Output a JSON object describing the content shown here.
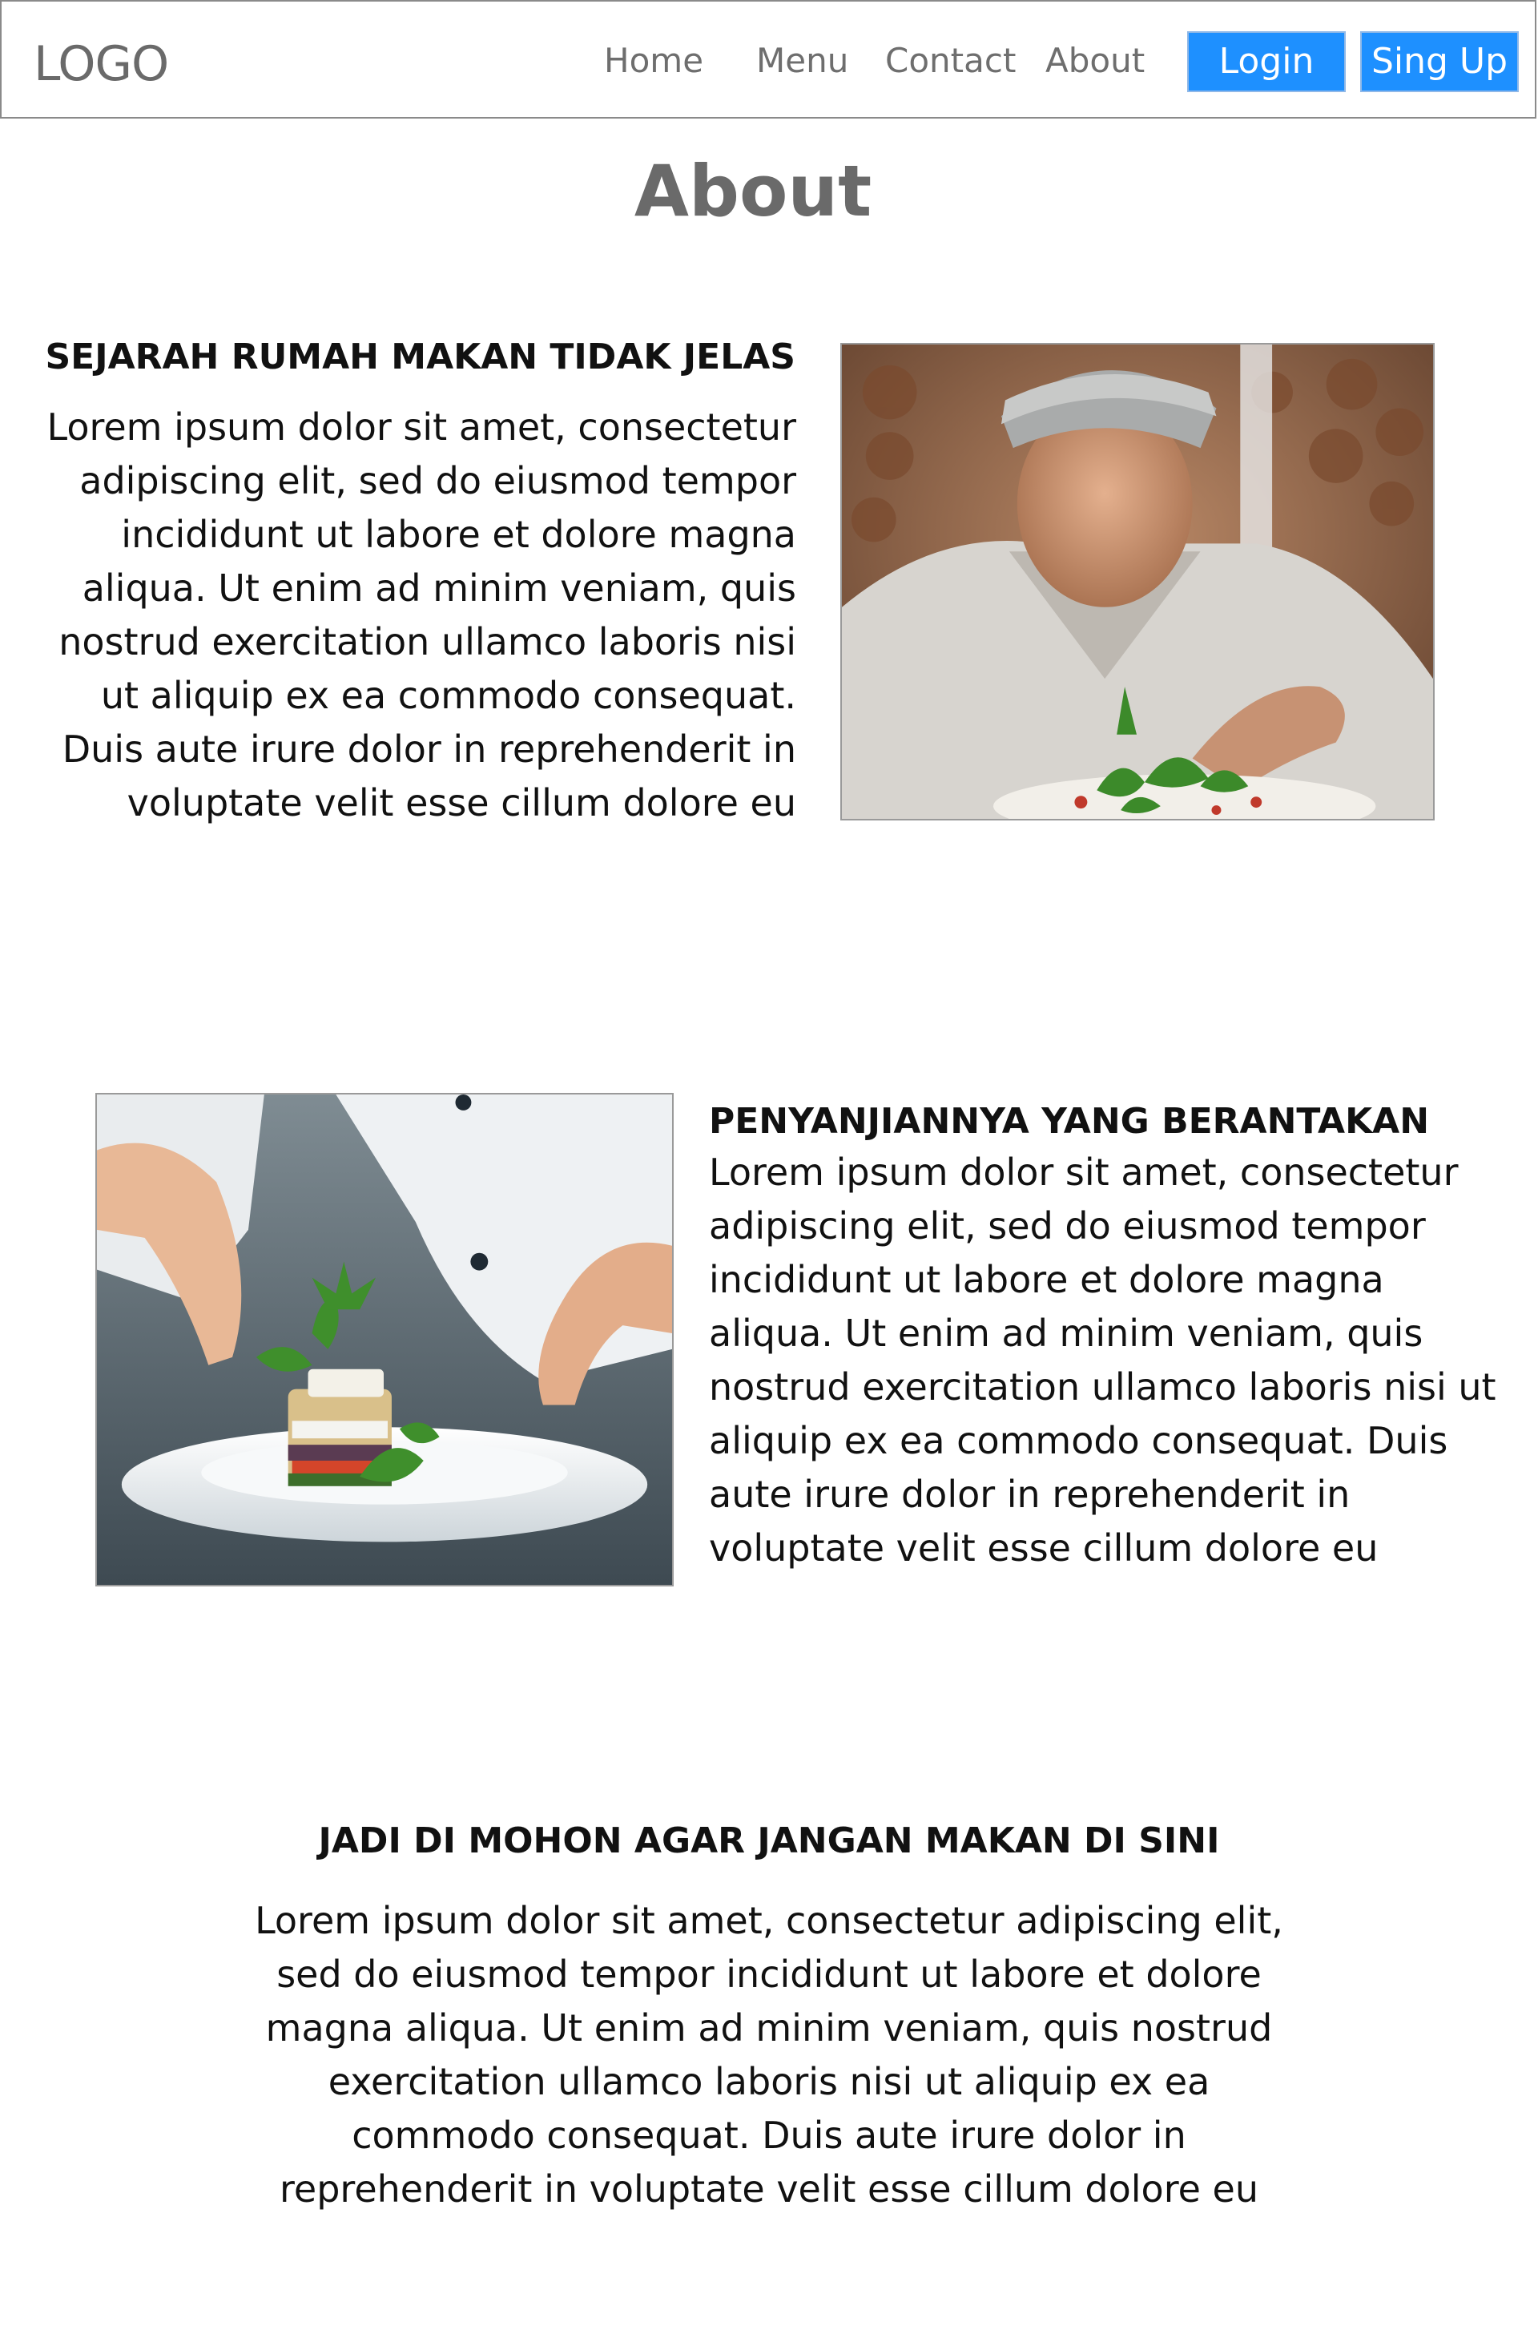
{
  "navbar": {
    "logo": "LOGO",
    "links": [
      "Home",
      "Menu",
      "Contact",
      "About"
    ],
    "login_label": "Login",
    "signup_label": "Sing Up",
    "accent": "#1e90ff"
  },
  "page": {
    "title": "About"
  },
  "sections": [
    {
      "heading": "SEJARAH RUMAH MAKAN TIDAK JELAS",
      "text": "Lorem ipsum dolor sit amet, consectetur adipiscing elit, sed do eiusmod tempor incididunt ut labore et dolore magna aliqua. Ut enim ad minim veniam, quis nostrud exercitation ullamco laboris nisi ut aliquip ex ea commodo consequat. Duis aute irure dolor in reprehenderit in voluptate velit esse cillum dolore eu",
      "image": "chef-garnishing-photo"
    },
    {
      "heading": "PENYANJIANNYA YANG BERANTAKAN",
      "text": "Lorem ipsum dolor sit amet, consectetur adipiscing elit, sed do eiusmod tempor incididunt ut labore et dolore magna aliqua. Ut enim ad minim veniam, quis nostrud exercitation ullamco laboris nisi ut aliquip ex ea commodo consequat. Duis aute irure dolor in reprehenderit in voluptate velit esse cillum dolore eu",
      "image": "plated-dish-photo"
    },
    {
      "heading": "JADI DI MOHON AGAR JANGAN MAKAN DI SINI",
      "text": "Lorem ipsum dolor sit amet, consectetur adipiscing elit, sed do eiusmod tempor incididunt ut labore et dolore magna aliqua. Ut enim ad minim veniam, quis nostrud exercitation ullamco laboris nisi ut aliquip ex ea commodo consequat. Duis aute irure dolor in reprehenderit in voluptate velit esse cillum dolore eu"
    }
  ]
}
